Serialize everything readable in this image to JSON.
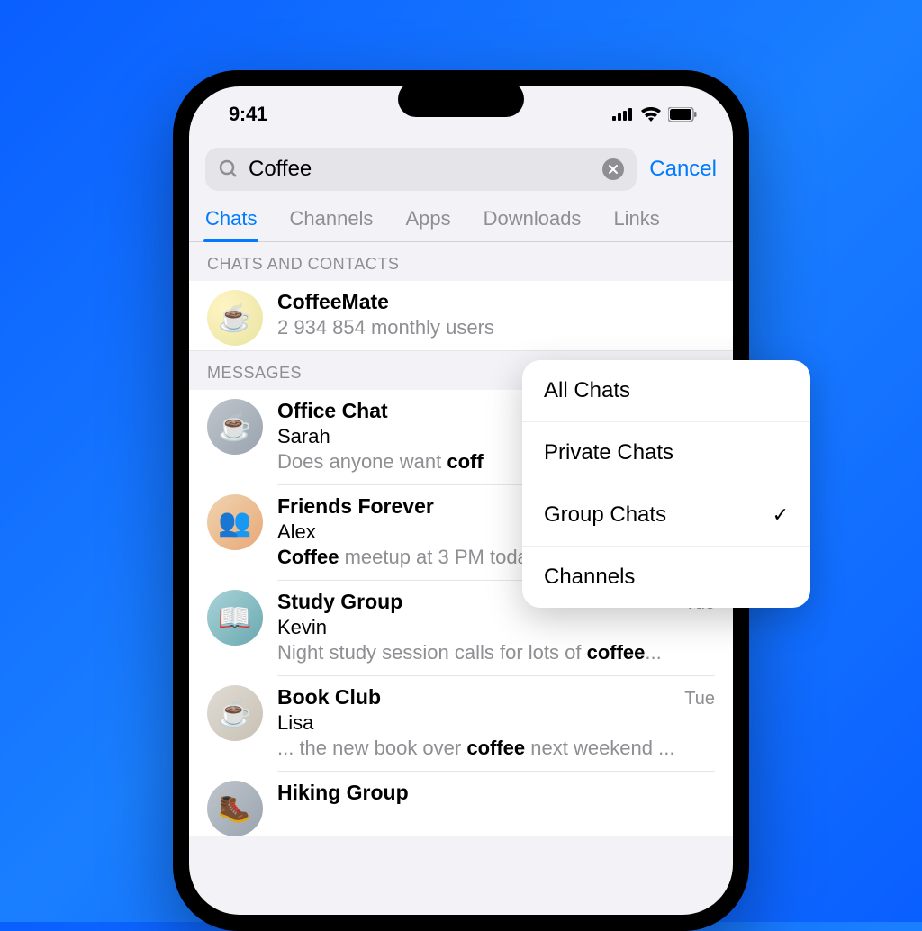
{
  "statusbar": {
    "time": "9:41"
  },
  "search": {
    "value": "Coffee",
    "cancel_label": "Cancel"
  },
  "tabs": [
    {
      "label": "Chats",
      "active": true
    },
    {
      "label": "Channels",
      "active": false
    },
    {
      "label": "Apps",
      "active": false
    },
    {
      "label": "Downloads",
      "active": false
    },
    {
      "label": "Links",
      "active": false
    }
  ],
  "sections": {
    "contacts_header": "CHATS AND CONTACTS",
    "messages_header": "MESSAGES"
  },
  "contact": {
    "icon": "☕",
    "title": "CoffeeMate",
    "subtitle": "2 934 854 monthly users"
  },
  "messages": [
    {
      "title": "Office Chat",
      "sender": "Sarah",
      "preview_pre": "Does anyone want ",
      "preview_hl": "coff",
      "preview_post": "",
      "time": "",
      "avatar_class": "gray",
      "icon": "☕"
    },
    {
      "title": "Friends Forever",
      "sender": "Alex",
      "preview_pre": "",
      "preview_hl": "Coffee",
      "preview_post": " meetup at 3 PM today?",
      "time": "",
      "avatar_class": "warm",
      "icon": "👥"
    },
    {
      "title": "Study Group",
      "sender": "Kevin",
      "preview_pre": "Night study session calls for lots of ",
      "preview_hl": "coffee",
      "preview_post": "...",
      "time": "Tue",
      "avatar_class": "teal",
      "icon": "📖"
    },
    {
      "title": "Book Club",
      "sender": "Lisa",
      "preview_pre": "... the new book over ",
      "preview_hl": "coffee",
      "preview_post": " next weekend ...",
      "time": "Tue",
      "avatar_class": "muted",
      "icon": "☕"
    },
    {
      "title": "Hiking Group",
      "sender": "",
      "preview_pre": "",
      "preview_hl": "",
      "preview_post": "",
      "time": "",
      "avatar_class": "gray",
      "icon": "🥾"
    }
  ],
  "popover": {
    "items": [
      {
        "label": "All Chats",
        "checked": false
      },
      {
        "label": "Private Chats",
        "checked": false
      },
      {
        "label": "Group Chats",
        "checked": true
      },
      {
        "label": "Channels",
        "checked": false
      }
    ]
  }
}
